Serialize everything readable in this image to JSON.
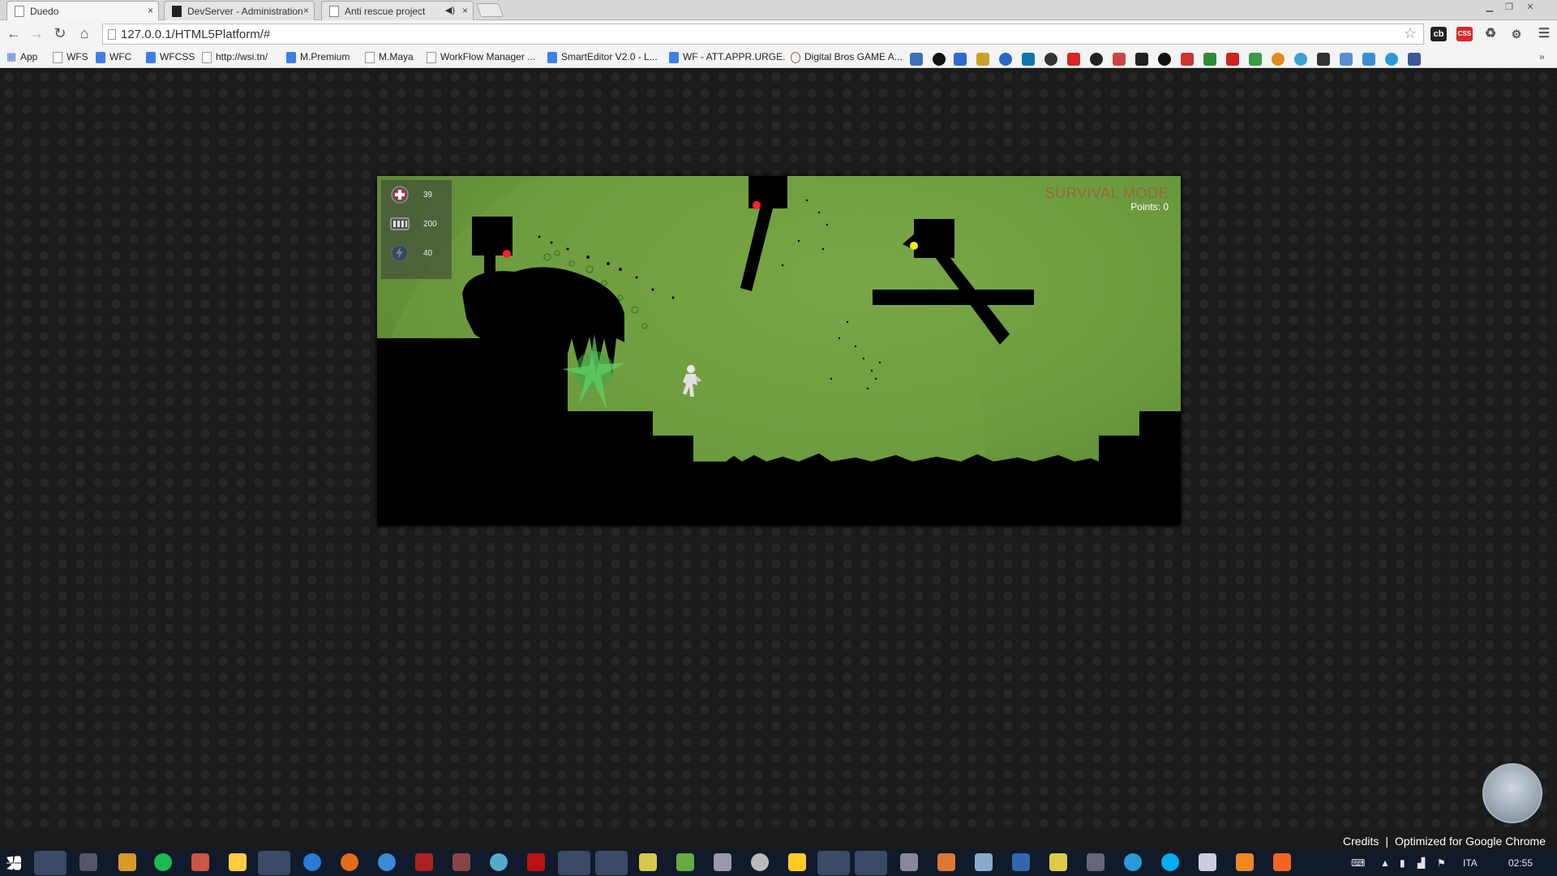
{
  "browser": {
    "tabs": [
      {
        "title": "Duedo",
        "active": true
      },
      {
        "title": "DevServer - Administration",
        "active": false
      },
      {
        "title": "Anti rescue project",
        "active": false,
        "audio": true
      }
    ],
    "close_glyph": "×",
    "address": "127.0.0.1/HTML5Platform/#"
  },
  "bookmarks": [
    {
      "label": "App",
      "icon": "apps-icon"
    },
    {
      "label": "WFS",
      "icon": "page-icon"
    },
    {
      "label": "WFC",
      "icon": "google-icon"
    },
    {
      "label": "WFCSS",
      "icon": "google-icon"
    },
    {
      "label": "http://wsi.tn/",
      "icon": "page-icon"
    },
    {
      "label": "M.Premium",
      "icon": "google-icon"
    },
    {
      "label": "M.Maya",
      "icon": "page-icon"
    },
    {
      "label": "WorkFlow Manager ...",
      "icon": "page-icon"
    },
    {
      "label": "SmartEditor V2.0 - L...",
      "icon": "google-icon"
    },
    {
      "label": "WF - ATT.APPR.URGE.",
      "icon": "google-icon"
    },
    {
      "label": "Digital Bros GAME A...",
      "icon": "gear-icon"
    }
  ],
  "hud": {
    "health": "39",
    "ammo": "200",
    "energy": "40"
  },
  "game": {
    "mode": "SURVIVAL MODE",
    "points": "Points: 0"
  },
  "footer": {
    "credits": "Credits",
    "separator": "|",
    "optimized": "Optimized for Google Chrome"
  },
  "taskbar": {
    "language": "ITA",
    "time": "02:55"
  },
  "colors": {
    "sky": "#6b9a3c",
    "enemy_eye_red": "#ff2222",
    "enemy_eye_yellow": "#ffee00",
    "mode_text": "#8f6a3e"
  }
}
